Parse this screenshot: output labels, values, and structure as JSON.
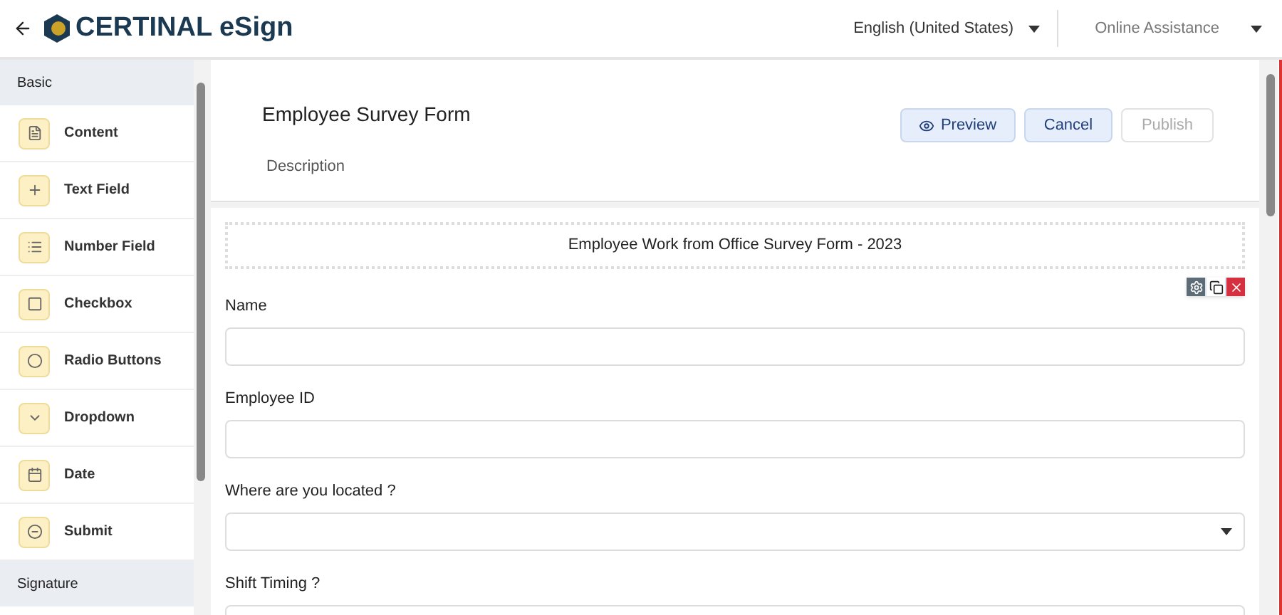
{
  "header": {
    "brand": "CERTINAL eSign",
    "language": "English (United States)",
    "assistance": "Online Assistance"
  },
  "sidebar": {
    "sections": [
      {
        "title": "Basic",
        "items": [
          {
            "label": "Content",
            "kind": "content"
          },
          {
            "label": "Text Field",
            "kind": "text"
          },
          {
            "label": "Number Field",
            "kind": "number"
          },
          {
            "label": "Checkbox",
            "kind": "checkbox"
          },
          {
            "label": "Radio Buttons",
            "kind": "radio"
          },
          {
            "label": "Dropdown",
            "kind": "dropdown"
          },
          {
            "label": "Date",
            "kind": "date"
          },
          {
            "label": "Submit",
            "kind": "submit"
          }
        ]
      },
      {
        "title": "Signature"
      }
    ]
  },
  "form": {
    "title": "Employee Survey Form",
    "description": "Description",
    "buttons": [
      {
        "label": "Preview",
        "kind": "preview",
        "disabled": false
      },
      {
        "label": "Cancel",
        "kind": "cancel",
        "disabled": false
      },
      {
        "label": "Publish",
        "kind": "publish",
        "disabled": true
      }
    ],
    "banner": "Employee Work from Office Survey Form - 2023",
    "fields": [
      {
        "label": "Name",
        "kind": "text",
        "selected": true
      },
      {
        "label": "Employee ID",
        "kind": "text",
        "selected": false
      },
      {
        "label": "Where are you located ?",
        "kind": "select",
        "selected": false
      },
      {
        "label": "Shift Timing ?",
        "kind": "text",
        "selected": false
      }
    ]
  }
}
